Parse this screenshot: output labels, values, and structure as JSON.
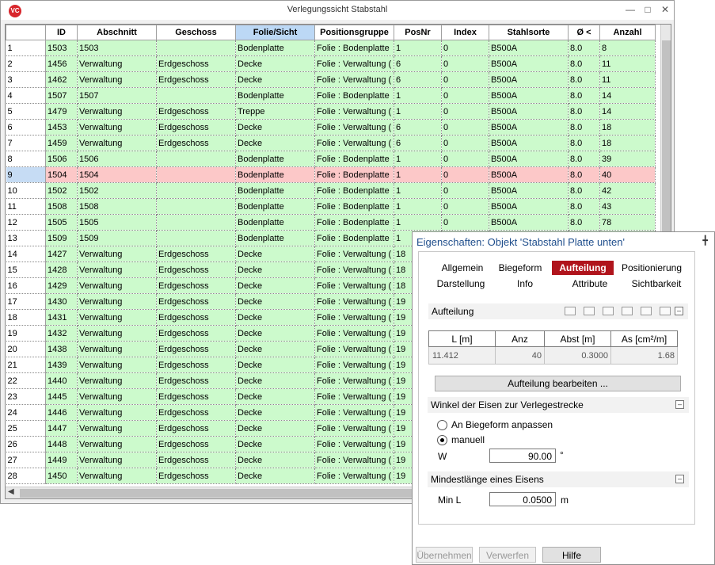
{
  "window": {
    "title": "Verlegungssicht Stabstahl",
    "logo": "VC"
  },
  "grid": {
    "columns": [
      "ID",
      "Abschnitt",
      "Geschoss",
      "Folie/Sicht",
      "Positionsgruppe",
      "PosNr",
      "Index",
      "Stahlsorte",
      "Ø <",
      "Anzahl"
    ],
    "selected_column": "Folie/Sicht",
    "rows": [
      [
        "1",
        "1503",
        "1503",
        "",
        "Bodenplatte",
        "Folie : Bodenplatte",
        "1",
        "0",
        "B500A",
        "8.0",
        "8"
      ],
      [
        "2",
        "1456",
        "Verwaltung",
        "Erdgeschoss",
        "Decke",
        "Folie : Verwaltung (",
        "6",
        "0",
        "B500A",
        "8.0",
        "11"
      ],
      [
        "3",
        "1462",
        "Verwaltung",
        "Erdgeschoss",
        "Decke",
        "Folie : Verwaltung (",
        "6",
        "0",
        "B500A",
        "8.0",
        "11"
      ],
      [
        "4",
        "1507",
        "1507",
        "",
        "Bodenplatte",
        "Folie : Bodenplatte",
        "1",
        "0",
        "B500A",
        "8.0",
        "14"
      ],
      [
        "5",
        "1479",
        "Verwaltung",
        "Erdgeschoss",
        "Treppe",
        "Folie : Verwaltung (",
        "1",
        "0",
        "B500A",
        "8.0",
        "14"
      ],
      [
        "6",
        "1453",
        "Verwaltung",
        "Erdgeschoss",
        "Decke",
        "Folie : Verwaltung (",
        "6",
        "0",
        "B500A",
        "8.0",
        "18"
      ],
      [
        "7",
        "1459",
        "Verwaltung",
        "Erdgeschoss",
        "Decke",
        "Folie : Verwaltung (",
        "6",
        "0",
        "B500A",
        "8.0",
        "18"
      ],
      [
        "8",
        "1506",
        "1506",
        "",
        "Bodenplatte",
        "Folie : Bodenplatte",
        "1",
        "0",
        "B500A",
        "8.0",
        "39"
      ],
      [
        "9",
        "1504",
        "1504",
        "",
        "Bodenplatte",
        "Folie : Bodenplatte",
        "1",
        "0",
        "B500A",
        "8.0",
        "40"
      ],
      [
        "10",
        "1502",
        "1502",
        "",
        "Bodenplatte",
        "Folie : Bodenplatte",
        "1",
        "0",
        "B500A",
        "8.0",
        "42"
      ],
      [
        "11",
        "1508",
        "1508",
        "",
        "Bodenplatte",
        "Folie : Bodenplatte",
        "1",
        "0",
        "B500A",
        "8.0",
        "43"
      ],
      [
        "12",
        "1505",
        "1505",
        "",
        "Bodenplatte",
        "Folie : Bodenplatte",
        "1",
        "0",
        "B500A",
        "8.0",
        "78"
      ],
      [
        "13",
        "1509",
        "1509",
        "",
        "Bodenplatte",
        "Folie : Bodenplatte",
        "1",
        "",
        "",
        "",
        ""
      ],
      [
        "14",
        "1427",
        "Verwaltung",
        "Erdgeschoss",
        "Decke",
        "Folie : Verwaltung (",
        "18",
        "",
        "",
        "",
        ""
      ],
      [
        "15",
        "1428",
        "Verwaltung",
        "Erdgeschoss",
        "Decke",
        "Folie : Verwaltung (",
        "18",
        "",
        "",
        "",
        ""
      ],
      [
        "16",
        "1429",
        "Verwaltung",
        "Erdgeschoss",
        "Decke",
        "Folie : Verwaltung (",
        "18",
        "",
        "",
        "",
        ""
      ],
      [
        "17",
        "1430",
        "Verwaltung",
        "Erdgeschoss",
        "Decke",
        "Folie : Verwaltung (",
        "19",
        "",
        "",
        "",
        ""
      ],
      [
        "18",
        "1431",
        "Verwaltung",
        "Erdgeschoss",
        "Decke",
        "Folie : Verwaltung (",
        "19",
        "",
        "",
        "",
        ""
      ],
      [
        "19",
        "1432",
        "Verwaltung",
        "Erdgeschoss",
        "Decke",
        "Folie : Verwaltung (",
        "19",
        "",
        "",
        "",
        ""
      ],
      [
        "20",
        "1438",
        "Verwaltung",
        "Erdgeschoss",
        "Decke",
        "Folie : Verwaltung (",
        "19",
        "",
        "",
        "",
        ""
      ],
      [
        "21",
        "1439",
        "Verwaltung",
        "Erdgeschoss",
        "Decke",
        "Folie : Verwaltung (",
        "19",
        "",
        "",
        "",
        ""
      ],
      [
        "22",
        "1440",
        "Verwaltung",
        "Erdgeschoss",
        "Decke",
        "Folie : Verwaltung (",
        "19",
        "",
        "",
        "",
        ""
      ],
      [
        "23",
        "1445",
        "Verwaltung",
        "Erdgeschoss",
        "Decke",
        "Folie : Verwaltung (",
        "19",
        "",
        "",
        "",
        ""
      ],
      [
        "24",
        "1446",
        "Verwaltung",
        "Erdgeschoss",
        "Decke",
        "Folie : Verwaltung (",
        "19",
        "",
        "",
        "",
        ""
      ],
      [
        "25",
        "1447",
        "Verwaltung",
        "Erdgeschoss",
        "Decke",
        "Folie : Verwaltung (",
        "19",
        "",
        "",
        "",
        ""
      ],
      [
        "26",
        "1448",
        "Verwaltung",
        "Erdgeschoss",
        "Decke",
        "Folie : Verwaltung (",
        "19",
        "",
        "",
        "",
        ""
      ],
      [
        "27",
        "1449",
        "Verwaltung",
        "Erdgeschoss",
        "Decke",
        "Folie : Verwaltung (",
        "19",
        "",
        "",
        "",
        ""
      ],
      [
        "28",
        "1450",
        "Verwaltung",
        "Erdgeschoss",
        "Decke",
        "Folie : Verwaltung (",
        "19",
        "",
        "",
        "",
        ""
      ]
    ],
    "highlighted_row": "9",
    "colors": {
      "row_green": "#ccfacc",
      "row_highlight": "#fcc8c8",
      "header_selected": "#bcd8f5"
    }
  },
  "panel": {
    "title": "Eigenschaften: Objekt 'Stabstahl Platte unten'",
    "tabs": [
      "Allgemein",
      "Biegeform",
      "Aufteilung",
      "Positionierung",
      "Darstellung",
      "Info",
      "Attribute",
      "Sichtbarkeit"
    ],
    "active_tab": "Aufteilung",
    "aufteilung": {
      "header": "Aufteilung",
      "columns": [
        "L [m]",
        "Anz",
        "Abst [m]",
        "As [cm²/m]"
      ],
      "row": [
        "11.412",
        "40",
        "0.3000",
        "1.68"
      ],
      "edit_button": "Aufteilung bearbeiten ..."
    },
    "winkel": {
      "header": "Winkel der Eisen zur Verlegestrecke",
      "option_auto": "An Biegeform anpassen",
      "option_manual": "manuell",
      "selected": "manuell",
      "w_label": "W",
      "w_value": "90.00",
      "w_unit": "°"
    },
    "mindest": {
      "header": "Mindestlänge eines Eisens",
      "label": "Min L",
      "value": "0.0500",
      "unit": "m"
    },
    "buttons": {
      "apply": "Übernehmen",
      "discard": "Verwerfen",
      "help": "Hilfe"
    },
    "accent": "#b0141c"
  }
}
